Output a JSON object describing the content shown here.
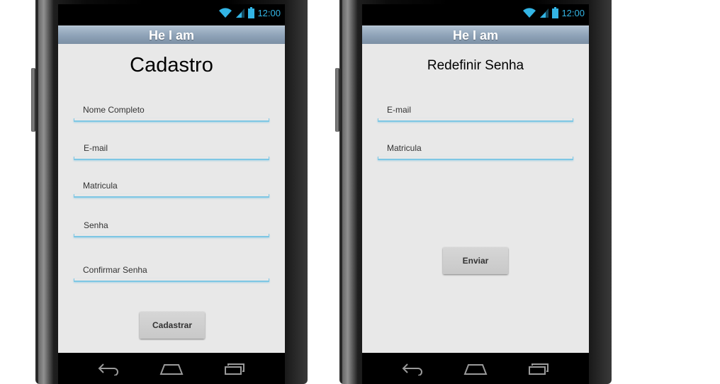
{
  "status_bar": {
    "time": "12:00",
    "icon_color": "#33b5e5"
  },
  "app_title": "He I am",
  "screens": [
    {
      "heading": "Cadastro",
      "fields": [
        {
          "hint": "Nome Completo"
        },
        {
          "hint": "E-mail"
        },
        {
          "hint": "Matricula"
        },
        {
          "hint": "Senha"
        },
        {
          "hint": "Confirmar Senha"
        }
      ],
      "button_label": "Cadastrar"
    },
    {
      "heading": "Redefinir Senha",
      "fields": [
        {
          "hint": "E-mail"
        },
        {
          "hint": "Matricula"
        }
      ],
      "button_label": "Enviar"
    }
  ],
  "nav_icons": [
    "back-icon",
    "home-icon",
    "recent-apps-icon"
  ],
  "colors": {
    "title_bar": "#8fa3b8",
    "content_bg": "#e8e8e8",
    "field_underline": "#7ec7e4"
  }
}
